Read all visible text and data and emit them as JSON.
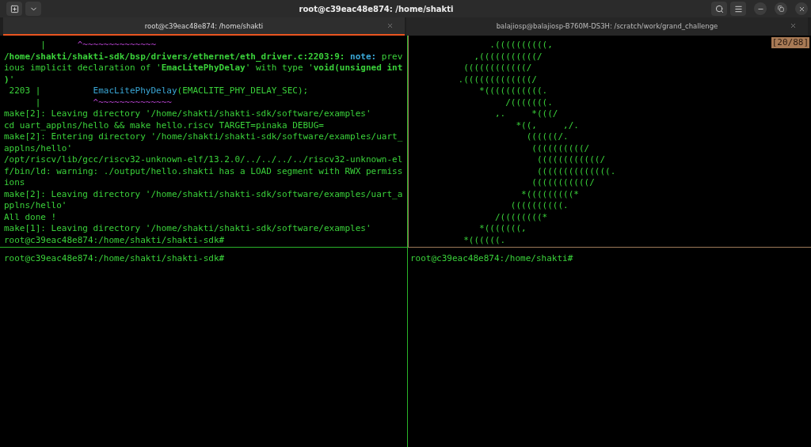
{
  "window": {
    "title": "root@c39eac48e874: /home/shakti"
  },
  "tabs": [
    {
      "label": "root@c39eac48e874: /home/shakti",
      "selected": true
    },
    {
      "label": "balajiosp@balajiosp-B760M-DS3H: /scratch/work/grand_challenge",
      "selected": false
    }
  ],
  "panes": [
    {
      "lines": [
        {
          "segments": [
            {
              "text": "       |      ",
              "kind": "plain"
            },
            {
              "text": "^~~~~~~~~~~~~~~",
              "kind": "caret"
            }
          ]
        },
        {
          "segments": [
            {
              "text": "/home/shakti/shakti-sdk/bsp/drivers/ethernet/eth_driver.c:2203:9:",
              "kind": "bold"
            },
            {
              "text": " note:",
              "kind": "note"
            },
            {
              "text": " prev",
              "kind": "plain"
            }
          ]
        },
        {
          "segments": [
            {
              "text": "ious implicit declaration of '",
              "kind": "plain"
            },
            {
              "text": "EmacLitePhyDelay",
              "kind": "bold"
            },
            {
              "text": "' with type '",
              "kind": "plain"
            },
            {
              "text": "void(unsigned int",
              "kind": "bold"
            }
          ]
        },
        {
          "segments": [
            {
              "text": ")",
              "kind": "bold"
            },
            {
              "text": "'",
              "kind": "plain"
            }
          ]
        },
        {
          "segments": [
            {
              "text": " 2203 |          ",
              "kind": "plain"
            },
            {
              "text": "EmacLitePhyDelay",
              "kind": "func"
            },
            {
              "text": "(EMACLITE_PHY_DELAY_SEC);",
              "kind": "plain"
            }
          ]
        },
        {
          "segments": [
            {
              "text": "      |          ",
              "kind": "plain"
            },
            {
              "text": "^~~~~~~~~~~~~~~",
              "kind": "caret"
            }
          ]
        },
        {
          "segments": [
            {
              "text": "make[2]: Leaving directory '/home/shakti/shakti-sdk/software/examples'",
              "kind": "plain"
            }
          ]
        },
        {
          "segments": [
            {
              "text": "cd uart_applns/hello && make hello.riscv TARGET=pinaka DEBUG=",
              "kind": "plain"
            }
          ]
        },
        {
          "segments": [
            {
              "text": "make[2]: Entering directory '/home/shakti/shakti-sdk/software/examples/uart_",
              "kind": "plain"
            }
          ]
        },
        {
          "segments": [
            {
              "text": "applns/hello'",
              "kind": "plain"
            }
          ]
        },
        {
          "segments": [
            {
              "text": "/opt/riscv/lib/gcc/riscv32-unknown-elf/13.2.0/../../../../riscv32-unknown-el",
              "kind": "plain"
            }
          ]
        },
        {
          "segments": [
            {
              "text": "f/bin/ld: warning: ./output/hello.shakti has a LOAD segment with RWX permiss",
              "kind": "plain"
            }
          ]
        },
        {
          "segments": [
            {
              "text": "ions",
              "kind": "plain"
            }
          ]
        },
        {
          "segments": [
            {
              "text": "make[2]: Leaving directory '/home/shakti/shakti-sdk/software/examples/uart_a",
              "kind": "plain"
            }
          ]
        },
        {
          "segments": [
            {
              "text": "pplns/hello'",
              "kind": "plain"
            }
          ]
        },
        {
          "segments": [
            {
              "text": "All done !",
              "kind": "plain"
            }
          ]
        },
        {
          "segments": [
            {
              "text": "make[1]: Leaving directory '/home/shakti/shakti-sdk/software/examples'",
              "kind": "plain"
            }
          ]
        },
        {
          "segments": [
            {
              "text": "root@c39eac48e874:/home/shakti/shakti-sdk#",
              "kind": "plain"
            }
          ]
        }
      ]
    },
    {
      "badge": "[20/88]",
      "lines": [
        {
          "segments": [
            {
              "text": "               .((((((((((,",
              "kind": "plain"
            }
          ]
        },
        {
          "segments": [
            {
              "text": "            ,(((((((((((/",
              "kind": "plain"
            }
          ]
        },
        {
          "segments": [
            {
              "text": "          ((((((((((((/",
              "kind": "plain"
            }
          ]
        },
        {
          "segments": [
            {
              "text": "         .(((((((((((((/",
              "kind": "plain"
            }
          ]
        },
        {
          "segments": [
            {
              "text": "             *(((((((((((.",
              "kind": "plain"
            }
          ]
        },
        {
          "segments": [
            {
              "text": "                  /(((((((.",
              "kind": "plain"
            }
          ]
        },
        {
          "segments": [
            {
              "text": "                ,.     *(((/",
              "kind": "plain"
            }
          ]
        },
        {
          "segments": [
            {
              "text": "                    *((,     ,/.",
              "kind": "plain"
            }
          ]
        },
        {
          "segments": [
            {
              "text": "                      ((((((/.",
              "kind": "plain"
            }
          ]
        },
        {
          "segments": [
            {
              "text": "                       ((((((((((/",
              "kind": "plain"
            }
          ]
        },
        {
          "segments": [
            {
              "text": "                        ((((((((((((/",
              "kind": "plain"
            }
          ]
        },
        {
          "segments": [
            {
              "text": "                        ((((((((((((((.",
              "kind": "plain"
            }
          ]
        },
        {
          "segments": [
            {
              "text": "                       (((((((((((/",
              "kind": "plain"
            }
          ]
        },
        {
          "segments": [
            {
              "text": "                     *(((((((((*",
              "kind": "plain"
            }
          ]
        },
        {
          "segments": [
            {
              "text": "                   ((((((((((.",
              "kind": "plain"
            }
          ]
        },
        {
          "segments": [
            {
              "text": "                /((((((((*",
              "kind": "plain"
            }
          ]
        },
        {
          "segments": [
            {
              "text": "             *(((((((,",
              "kind": "plain"
            }
          ]
        },
        {
          "segments": [
            {
              "text": "          *((((((.",
              "kind": "plain"
            }
          ]
        }
      ]
    },
    {
      "lines": [
        {
          "segments": [
            {
              "text": "root@c39eac48e874:/home/shakti/shakti-sdk#",
              "kind": "plain"
            }
          ]
        }
      ]
    },
    {
      "lines": [
        {
          "segments": [
            {
              "text": "root@c39eac48e874:/home/shakti#",
              "kind": "plain"
            }
          ]
        }
      ]
    }
  ]
}
